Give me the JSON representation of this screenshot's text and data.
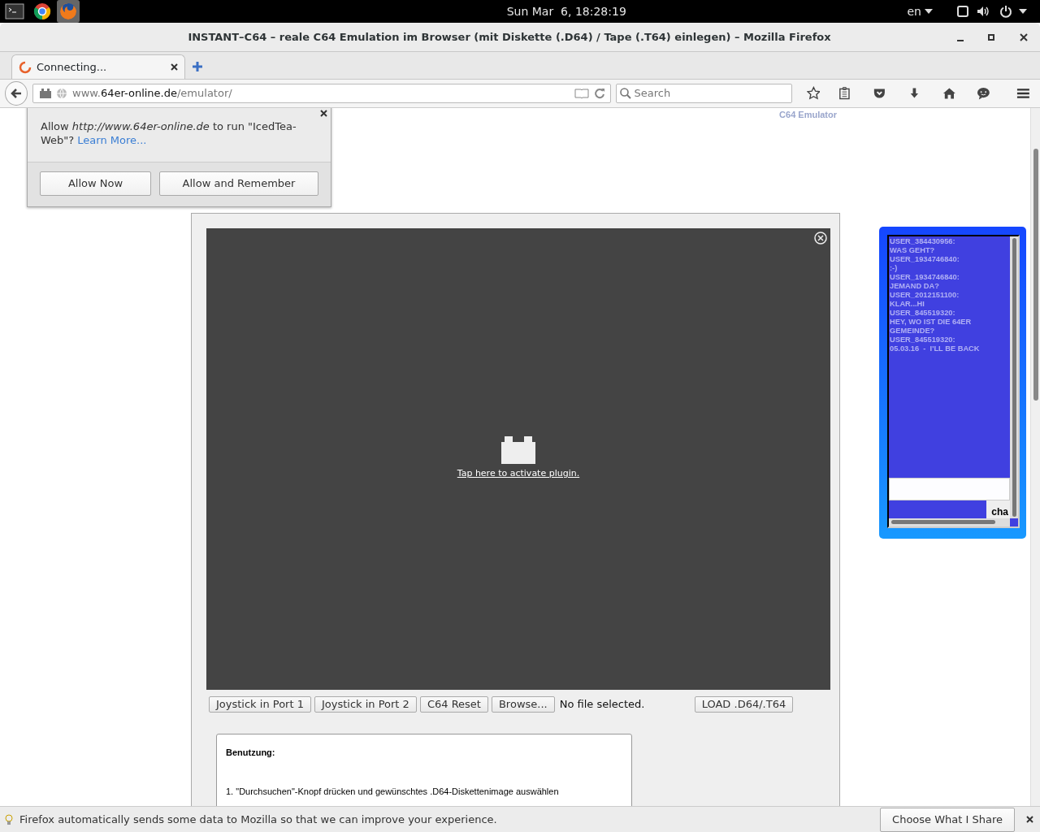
{
  "topbar": {
    "clock": "Sun Mar  6, 18:28:19",
    "language": "en"
  },
  "window": {
    "title": "INSTANT–C64 – reale C64 Emulation im Browser (mit Diskette (.D64) / Tape (.T64) einlegen) – Mozilla Firefox"
  },
  "tabs": [
    {
      "label": "Connecting...",
      "selected": true
    }
  ],
  "address": {
    "host_prefix": "www.",
    "domain": "64er-online.de",
    "path": "/emulator/"
  },
  "search": {
    "placeholder": "Search"
  },
  "permission_popup": {
    "message": "Allow *http://www.64er-online.de* to run \"IcedTea-Web\"?",
    "link": "Learn More...",
    "buttons": [
      {
        "label": "Allow Now"
      },
      {
        "label": "Allow and Remember"
      }
    ]
  },
  "page": {
    "breadcrumb": "C64 Emulator",
    "plugin": {
      "link": "Tap here to activate plugin."
    },
    "controls": [
      {
        "kind": "button",
        "label": "Joystick in Port 1"
      },
      {
        "kind": "button",
        "label": "Joystick in Port 2"
      },
      {
        "kind": "button",
        "label": "C64 Reset"
      },
      {
        "kind": "file",
        "label": "Browse...",
        "status": "No file selected."
      },
      {
        "kind": "button",
        "label": "LOAD .D64/.T64"
      }
    ],
    "usage": {
      "title": "Benutzung:",
      "steps": [
        "1. \"Durchsuchen\"-Knopf drücken und gewünschtes .D64-Diskettenimage auswählen"
      ]
    }
  },
  "chat": {
    "messages": [
      {
        "user": "USER_384430956:",
        "text": "WAS GEHT?"
      },
      {
        "user": "USER_1934746840:",
        "text": ":-)"
      },
      {
        "user": "USER_1934746840:",
        "text": "JEMAND DA?"
      },
      {
        "user": "USER_2012151100:",
        "text": "KLAR...HI"
      },
      {
        "user": "USER_845519320:",
        "text": "HEY, WO IST DIE 64ER GEMEINDE?"
      },
      {
        "user": "USER_845519320:",
        "text": "05.03.16  -  I'LL BE BACK"
      }
    ],
    "send_button": "cha"
  },
  "notification": {
    "message": "Firefox automatically sends some data to Mozilla so that we can improve your experience.",
    "button": {
      "label": "Choose What I Share"
    }
  }
}
